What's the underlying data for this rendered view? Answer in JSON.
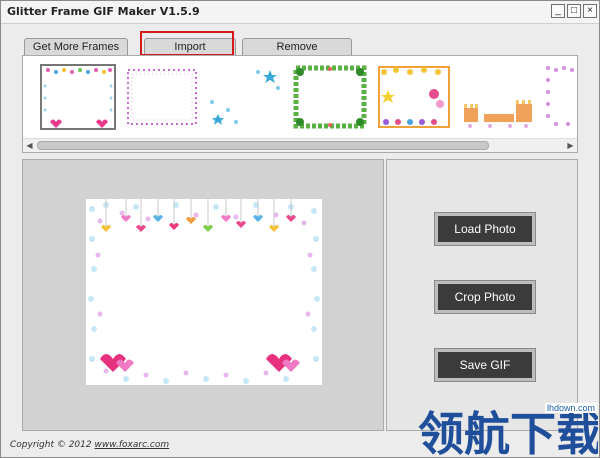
{
  "window": {
    "title": "Glitter Frame GIF Maker V1.5.9",
    "controls": {
      "minimize": "_",
      "maximize": "□",
      "close": "×"
    }
  },
  "tabs": [
    {
      "label": "Get More Frames"
    },
    {
      "label": "Import"
    },
    {
      "label": "Remove"
    }
  ],
  "frames": [
    {
      "name": "hearts-pink",
      "selected": true
    },
    {
      "name": "dots-purple",
      "selected": false
    },
    {
      "name": "stars-blue",
      "selected": false
    },
    {
      "name": "leaves-green",
      "selected": false
    },
    {
      "name": "flowers-yellow",
      "selected": false
    },
    {
      "name": "castle-pink",
      "selected": false
    },
    {
      "name": "dots-pink",
      "selected": false
    }
  ],
  "buttons": {
    "load": "Load Photo",
    "crop": "Crop Photo",
    "save": "Save GIF"
  },
  "footer": {
    "copyright": "Copyright © 2012",
    "url": "www.foxarc.com"
  },
  "watermark": {
    "site": "lhdown.com",
    "text": "领航下载"
  },
  "colors": {
    "highlight": "#d61a1a",
    "button": "#3b3b3b"
  }
}
